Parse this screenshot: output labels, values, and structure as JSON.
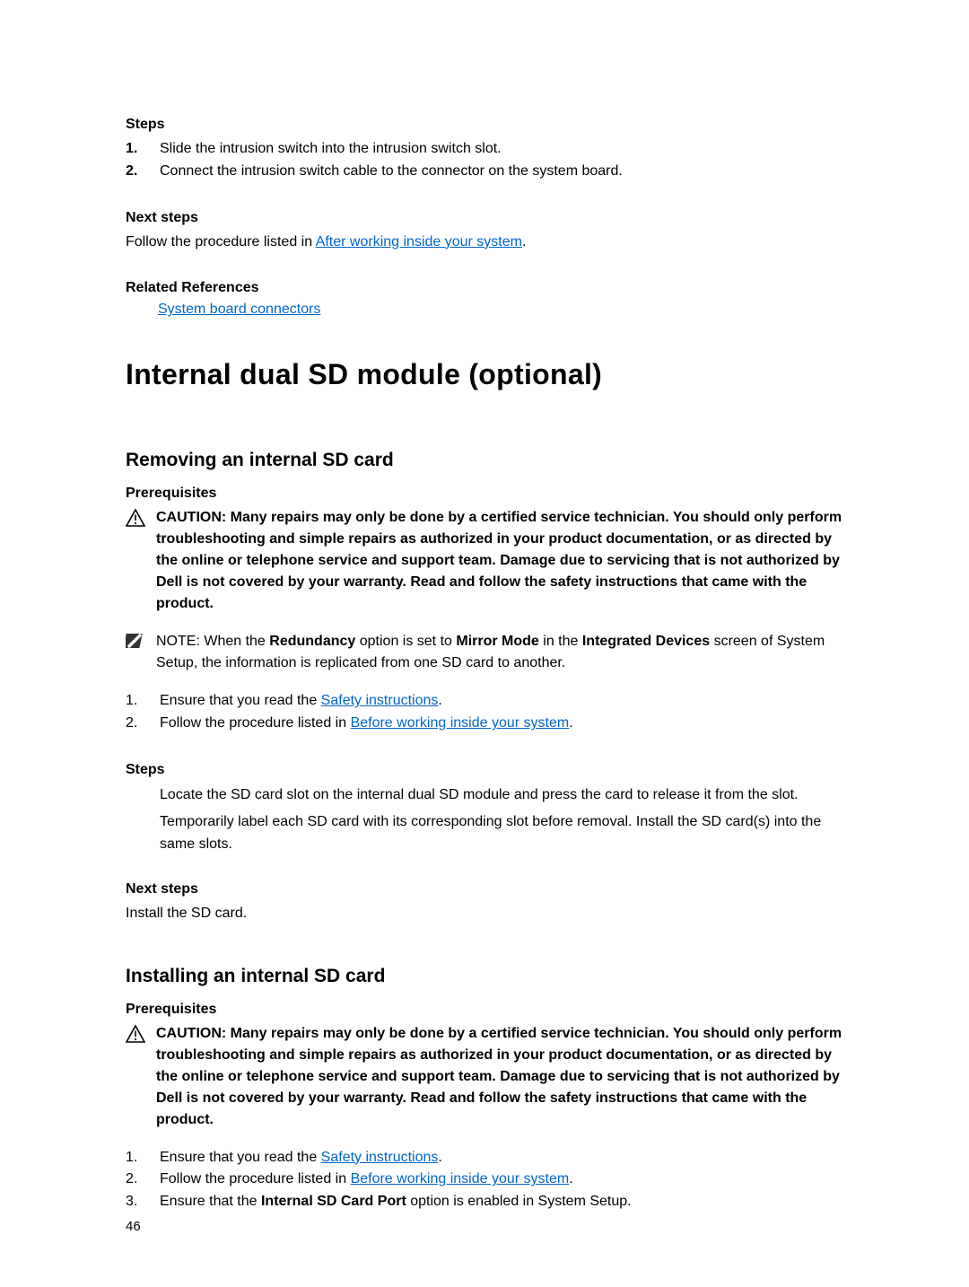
{
  "steps_heading": "Steps",
  "steps_top": [
    {
      "n": "1.",
      "text": "Slide the intrusion switch into the intrusion switch slot."
    },
    {
      "n": "2.",
      "text": "Connect the intrusion switch cable to the connector on the system board."
    }
  ],
  "next_steps_heading": "Next steps",
  "next_steps_top_prefix": "Follow the procedure listed in ",
  "next_steps_top_link": "After working inside your system",
  "next_steps_top_suffix": ".",
  "related_refs_heading": "Related References",
  "related_refs_link": "System board connectors",
  "h1": "Internal dual SD module (optional)",
  "remove": {
    "h2": "Removing an internal SD card",
    "prereq_heading": "Prerequisites",
    "caution_label": "CAUTION: ",
    "caution_text": "Many repairs may only be done by a certified service technician. You should only perform troubleshooting and simple repairs as authorized in your product documentation, or as directed by the online or telephone service and support team. Damage due to servicing that is not authorized by Dell is not covered by your warranty. Read and follow the safety instructions that came with the product.",
    "note_label": "NOTE: ",
    "note_pre": "When the ",
    "note_b1": "Redundancy",
    "note_mid1": " option is set to ",
    "note_b2": "Mirror Mode",
    "note_mid2": " in the ",
    "note_b3": "Integrated Devices",
    "note_post": " screen of System Setup, the information is replicated from one SD card to another.",
    "li1_pre": "Ensure that you read the ",
    "li1_link": "Safety instructions",
    "li1_post": ".",
    "li2_pre": "Follow the procedure listed in ",
    "li2_link": "Before working inside your system",
    "li2_post": ".",
    "steps_heading": "Steps",
    "step_a": "Locate the SD card slot on the internal dual SD module and press the card to release it from the slot.",
    "step_b": "Temporarily label each SD card with its corresponding slot before removal. Install the SD card(s) into the same slots.",
    "next_heading": "Next steps",
    "next_text": "Install the SD card."
  },
  "install": {
    "h2": "Installing an internal SD card",
    "prereq_heading": "Prerequisites",
    "caution_label": "CAUTION: ",
    "caution_text": "Many repairs may only be done by a certified service technician. You should only perform troubleshooting and simple repairs as authorized in your product documentation, or as directed by the online or telephone service and support team. Damage due to servicing that is not authorized by Dell is not covered by your warranty. Read and follow the safety instructions that came with the product.",
    "li1_pre": "Ensure that you read the ",
    "li1_link": "Safety instructions",
    "li1_post": ".",
    "li2_pre": "Follow the procedure listed in ",
    "li2_link": "Before working inside your system",
    "li2_post": ".",
    "li3_pre": "Ensure that the ",
    "li3_b": "Internal SD Card Port",
    "li3_post": " option is enabled in System Setup."
  },
  "page_number": "46"
}
